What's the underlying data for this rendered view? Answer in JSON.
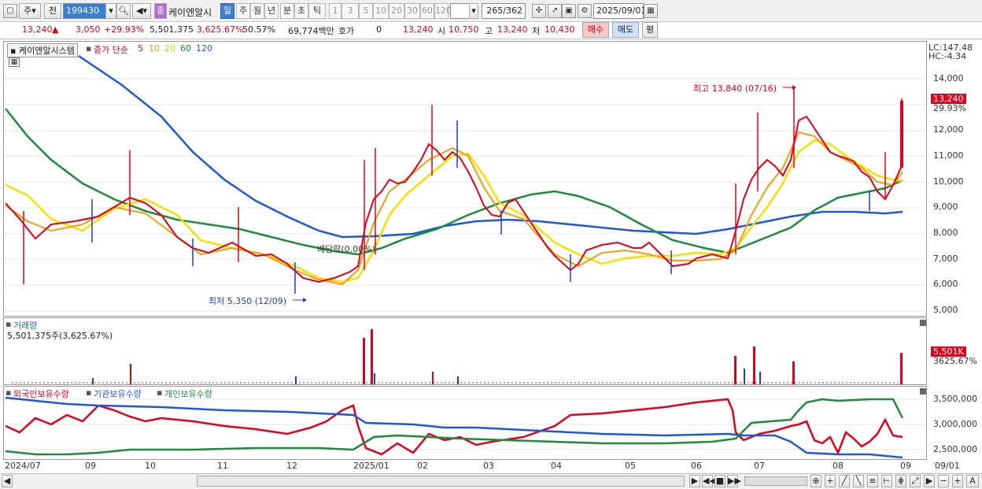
{
  "toolbar": {
    "period_weekly": "주",
    "period_prev": "전",
    "stock_code": "199430",
    "stock_badge": "종",
    "stock_name": "케이엔알시",
    "tabs": [
      "일",
      "주",
      "월",
      "년",
      "분",
      "초",
      "틱"
    ],
    "intervals": [
      "1",
      "3",
      "5",
      "10",
      "20",
      "30",
      "60",
      "120"
    ],
    "count": "265",
    "total": "/362",
    "date": "2025/09/01"
  },
  "quote": {
    "price": "13,240",
    "change": "3,050",
    "change_pct": "+29.93%",
    "volume": "5,501,375",
    "volume_pct": "3,625.67%",
    "turnover_pct": "50.57%",
    "amount": "69,774백만",
    "hoga_label": "호가",
    "hoga_value": "0",
    "current": "13,240",
    "open_label": "시",
    "open": "10,750",
    "high_label": "고",
    "high": "13,240",
    "low_label": "저",
    "low": "10,430",
    "buy_button": "매수",
    "sell_button": "매도",
    "eval_button": "평"
  },
  "main_panel": {
    "stock_label": "케이엔알시스템",
    "ma_label": "종가 단순",
    "ma_periods": [
      "5",
      "10",
      "20",
      "60",
      "120"
    ],
    "ma_colors": [
      "#e0001b",
      "#f39c12",
      "#f5e000",
      "#1e8a3a",
      "#1e58d8"
    ],
    "lc": "LC:147.48",
    "hc": "HC:-4.34",
    "max_annotation": "최고 13,840 (07/16)",
    "min_annotation": "최저 5,350 (12/09)",
    "div_annotation": "배당락(0.00%)",
    "last_price": "13,240",
    "last_pct": "29.93%",
    "y_ticks": [
      "14,000",
      "13,000",
      "12,000",
      "11,000",
      "10,000",
      "9,000",
      "8,000",
      "7,000",
      "6,000",
      "5,000"
    ]
  },
  "volume_panel": {
    "title": "거래량",
    "value": "5,501,375주(3,625.67%)",
    "last": "5,501K",
    "last_pct": "3625.67%"
  },
  "holding_panel": {
    "series": [
      "외국인보유수량",
      "기관보유수량",
      "개인보유수량"
    ],
    "colors": [
      "#e0001b",
      "#1e58d8",
      "#1e8a3a"
    ],
    "y_ticks": [
      "3,500,000",
      "3,000,000",
      "2,500,000"
    ]
  },
  "x_axis": {
    "labels": [
      "2024/07",
      "09",
      "10",
      "11",
      "12",
      "2025/01",
      "02",
      "03",
      "04",
      "05",
      "06",
      "07",
      "08",
      "09"
    ],
    "right_label": "09/01"
  },
  "chart_data": {
    "type": "candlestick",
    "y_range": [
      5000,
      14500
    ],
    "months_x": [
      "2024/07",
      "09",
      "10",
      "11",
      "12",
      "2025/01",
      "02",
      "03",
      "04",
      "05",
      "06",
      "07",
      "08",
      "09"
    ],
    "close_approx": [
      9000,
      8300,
      8500,
      9500,
      8200,
      7200,
      7000,
      6200,
      5350,
      6100,
      6500,
      9500,
      10800,
      12500,
      11000,
      10300,
      8600,
      9200,
      7500,
      6700,
      7300,
      7600,
      7700,
      7100,
      6900,
      7200,
      10000,
      11500,
      13840,
      11000,
      10900,
      9200,
      10400,
      13240
    ]
  }
}
